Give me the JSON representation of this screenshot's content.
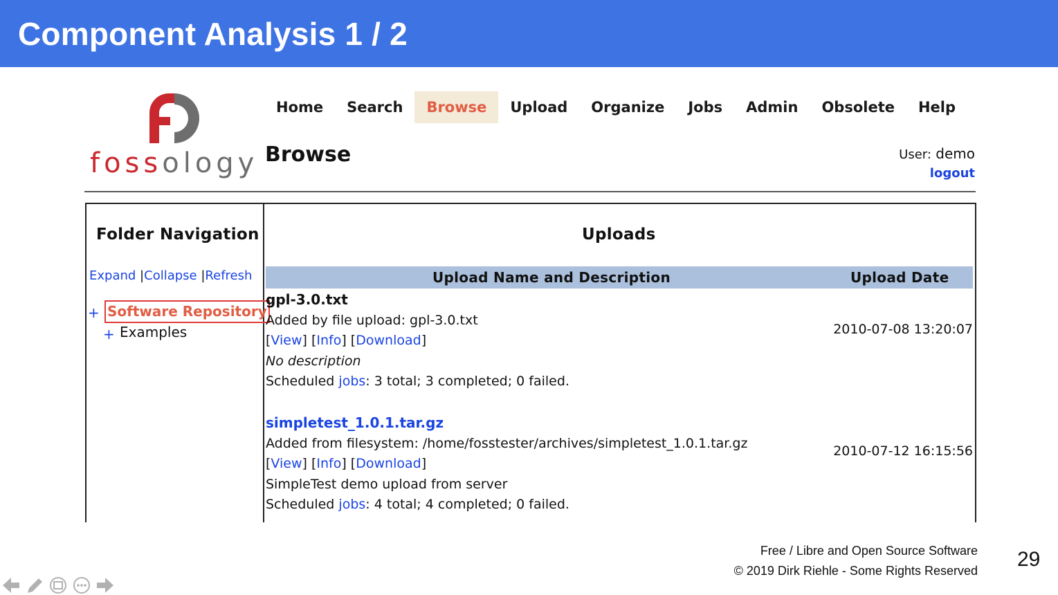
{
  "slide": {
    "title": "Component Analysis 1 / 2",
    "footer_line1": "Free / Libre and Open Source Software",
    "footer_line2": "© 2019 Dirk Riehle - Some Rights Reserved",
    "page_number": "29"
  },
  "app": {
    "logo_text_red": "foss",
    "logo_text_gray": "ology",
    "nav": [
      "Home",
      "Search",
      "Browse",
      "Upload",
      "Organize",
      "Jobs",
      "Admin",
      "Obsolete",
      "Help"
    ],
    "active_nav": "Browse",
    "page_title": "Browse",
    "user_label": "User:",
    "user_name": "demo",
    "logout_label": "logout"
  },
  "folder_nav": {
    "heading": "Folder Navigation",
    "expand": "Expand",
    "collapse": "Collapse",
    "refresh": "Refresh",
    "root": "Software Repository",
    "child": "Examples",
    "plus": "+"
  },
  "uploads": {
    "heading": "Uploads",
    "col_name": "Upload Name and Description",
    "col_date": "Upload Date",
    "view": "View",
    "info": "Info",
    "download": "Download",
    "jobs_link": "jobs",
    "rows": [
      {
        "name": "gpl-3.0.txt",
        "added": "Added by file upload: gpl-3.0.txt",
        "description": "No description",
        "scheduled_prefix": "Scheduled ",
        "jobs_summary": ": 3 total; 3 completed; 0 failed.",
        "date": "2010-07-08 13:20:07"
      },
      {
        "name": "simpletest_1.0.1.tar.gz",
        "added": "Added from filesystem: /home/fosstester/archives/simpletest_1.0.1.tar.gz",
        "description": "SimpleTest demo upload from server",
        "scheduled_prefix": "Scheduled ",
        "jobs_summary": ": 4 total; 4 completed; 0 failed.",
        "date": "2010-07-12 16:15:56"
      }
    ]
  },
  "colors": {
    "header_blue": "#3e73e3",
    "link_blue": "#1a44e0",
    "active_tab_bg": "#f3ead7",
    "active_tab_text": "#e25d44",
    "table_header_bg": "#aac0dc",
    "logo_red": "#c9282e"
  },
  "icons": [
    "fossology-logo-icon",
    "prev-arrow-icon",
    "pen-icon",
    "slides-icon",
    "more-icon",
    "next-arrow-icon"
  ]
}
